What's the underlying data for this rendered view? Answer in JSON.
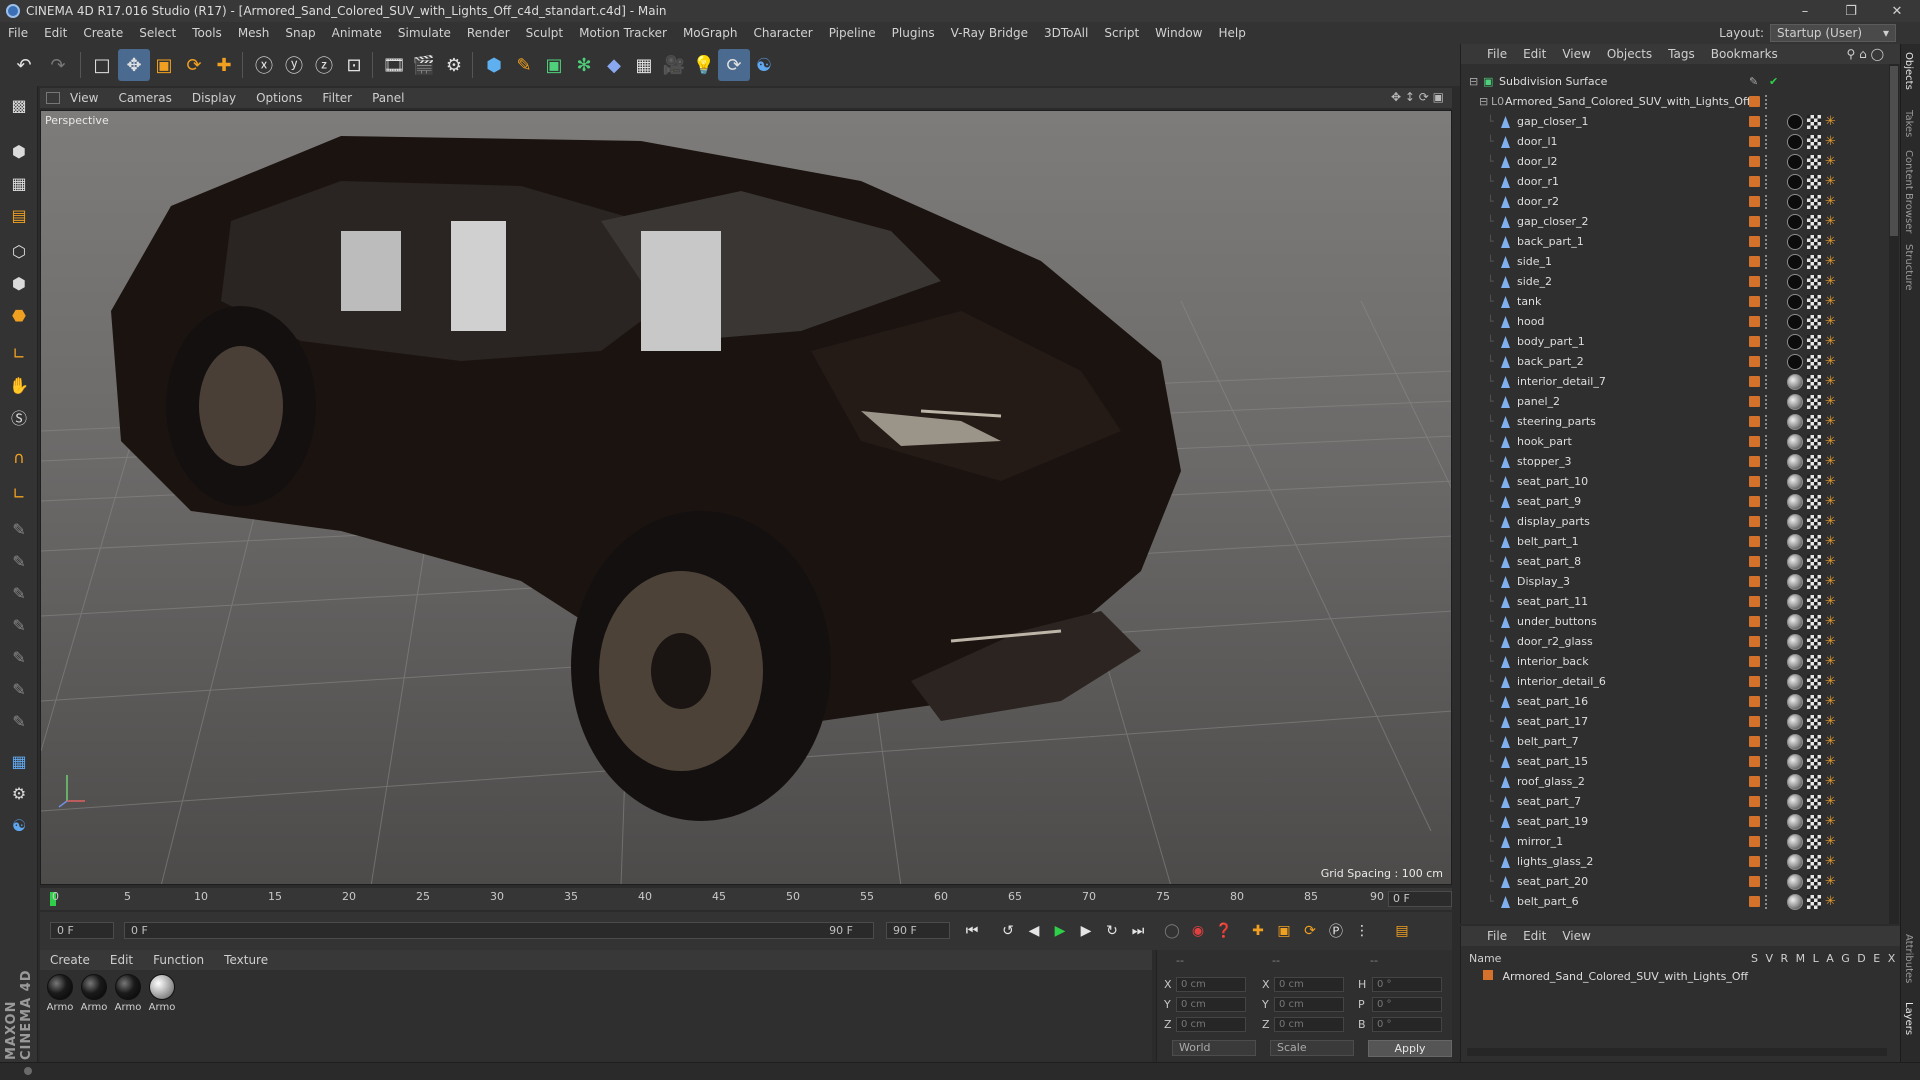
{
  "window": {
    "title": "CINEMA 4D R17.016 Studio (R17) - [Armored_Sand_Colored_SUV_with_Lights_Off_c4d_standart.c4d] - Main"
  },
  "menu": [
    "File",
    "Edit",
    "Create",
    "Select",
    "Tools",
    "Mesh",
    "Snap",
    "Animate",
    "Simulate",
    "Render",
    "Sculpt",
    "Motion Tracker",
    "MoGraph",
    "Character",
    "Pipeline",
    "Plugins",
    "V-Ray Bridge",
    "3DToAll",
    "Script",
    "Window",
    "Help"
  ],
  "layout": {
    "label": "Layout:",
    "value": "Startup (User)"
  },
  "viewport": {
    "menu": [
      "View",
      "Cameras",
      "Display",
      "Options",
      "Filter",
      "Panel"
    ],
    "label": "Perspective",
    "grid_spacing": "Grid Spacing : 100 cm"
  },
  "timeline": {
    "ticks": [
      "0",
      "5",
      "10",
      "15",
      "20",
      "25",
      "30",
      "35",
      "40",
      "45",
      "50",
      "55",
      "60",
      "65",
      "70",
      "75",
      "80",
      "85",
      "90"
    ],
    "frame_display": "0 F",
    "start_field": "0 F",
    "range_start": "0 F",
    "range_end": "90 F",
    "end_field": "90 F"
  },
  "material_manager": {
    "menu": [
      "Create",
      "Edit",
      "Function",
      "Texture"
    ],
    "materials": [
      {
        "label": "Armo",
        "style": "dark"
      },
      {
        "label": "Armo",
        "style": "dark"
      },
      {
        "label": "Armo",
        "style": "dark"
      },
      {
        "label": "Armo",
        "style": "white"
      }
    ]
  },
  "coordinates": {
    "header_left": "--",
    "header_mid": "--",
    "header_right": "--",
    "rows": [
      {
        "a": "X",
        "a_val": "0 cm",
        "b": "X",
        "b_val": "0 cm",
        "c": "H",
        "c_val": "0 °"
      },
      {
        "a": "Y",
        "a_val": "0 cm",
        "b": "Y",
        "b_val": "0 cm",
        "c": "P",
        "c_val": "0 °"
      },
      {
        "a": "Z",
        "a_val": "0 cm",
        "b": "Z",
        "b_val": "0 cm",
        "c": "B",
        "c_val": "0 °"
      }
    ],
    "mode": "World",
    "transform": "Scale",
    "apply": "Apply"
  },
  "object_manager": {
    "menu": [
      "File",
      "Edit",
      "View",
      "Objects",
      "Tags",
      "Bookmarks"
    ],
    "root": "Subdivision Surface",
    "group": "Armored_Sand_Colored_SUV_with_Lights_Off",
    "objects": [
      {
        "name": "gap_closer_1",
        "tex": "dark"
      },
      {
        "name": "door_l1",
        "tex": "dark"
      },
      {
        "name": "door_l2",
        "tex": "dark"
      },
      {
        "name": "door_r1",
        "tex": "dark"
      },
      {
        "name": "door_r2",
        "tex": "dark"
      },
      {
        "name": "gap_closer_2",
        "tex": "dark"
      },
      {
        "name": "back_part_1",
        "tex": "dark"
      },
      {
        "name": "side_1",
        "tex": "dark"
      },
      {
        "name": "side_2",
        "tex": "dark"
      },
      {
        "name": "tank",
        "tex": "dark"
      },
      {
        "name": "hood",
        "tex": "dark"
      },
      {
        "name": "body_part_1",
        "tex": "dark"
      },
      {
        "name": "back_part_2",
        "tex": "dark"
      },
      {
        "name": "interior_detail_7",
        "tex": "lite"
      },
      {
        "name": "panel_2",
        "tex": "lite"
      },
      {
        "name": "steering_parts",
        "tex": "lite"
      },
      {
        "name": "hook_part",
        "tex": "lite"
      },
      {
        "name": "stopper_3",
        "tex": "lite"
      },
      {
        "name": "seat_part_10",
        "tex": "lite"
      },
      {
        "name": "seat_part_9",
        "tex": "lite"
      },
      {
        "name": "display_parts",
        "tex": "lite"
      },
      {
        "name": "belt_part_1",
        "tex": "lite"
      },
      {
        "name": "seat_part_8",
        "tex": "lite"
      },
      {
        "name": "Display_3",
        "tex": "lite"
      },
      {
        "name": "seat_part_11",
        "tex": "lite"
      },
      {
        "name": "under_buttons",
        "tex": "lite"
      },
      {
        "name": "door_r2_glass",
        "tex": "lite"
      },
      {
        "name": "interior_back",
        "tex": "lite"
      },
      {
        "name": "interior_detail_6",
        "tex": "lite"
      },
      {
        "name": "seat_part_16",
        "tex": "lite"
      },
      {
        "name": "seat_part_17",
        "tex": "lite"
      },
      {
        "name": "belt_part_7",
        "tex": "lite"
      },
      {
        "name": "seat_part_15",
        "tex": "lite"
      },
      {
        "name": "roof_glass_2",
        "tex": "lite"
      },
      {
        "name": "seat_part_7",
        "tex": "lite"
      },
      {
        "name": "seat_part_19",
        "tex": "lite"
      },
      {
        "name": "mirror_1",
        "tex": "lite"
      },
      {
        "name": "lights_glass_2",
        "tex": "lite"
      },
      {
        "name": "seat_part_20",
        "tex": "lite"
      },
      {
        "name": "belt_part_6",
        "tex": "lite"
      }
    ]
  },
  "layer_manager": {
    "menu": [
      "File",
      "Edit",
      "View"
    ],
    "header_name": "Name",
    "header_cols": "S V R M L A G D E X",
    "layer": "Armored_Sand_Colored_SUV_with_Lights_Off"
  },
  "side_tabs": [
    "Objects",
    "Takes",
    "Content Browser",
    "Structure"
  ],
  "side_tabs_lower": [
    "Attributes",
    "Layers"
  ],
  "brand": "MAXON CINEMA 4D",
  "colors": {
    "accent": "#d4722c",
    "play_green": "#2fcf4a",
    "selection_blue": "#4a6a90"
  }
}
